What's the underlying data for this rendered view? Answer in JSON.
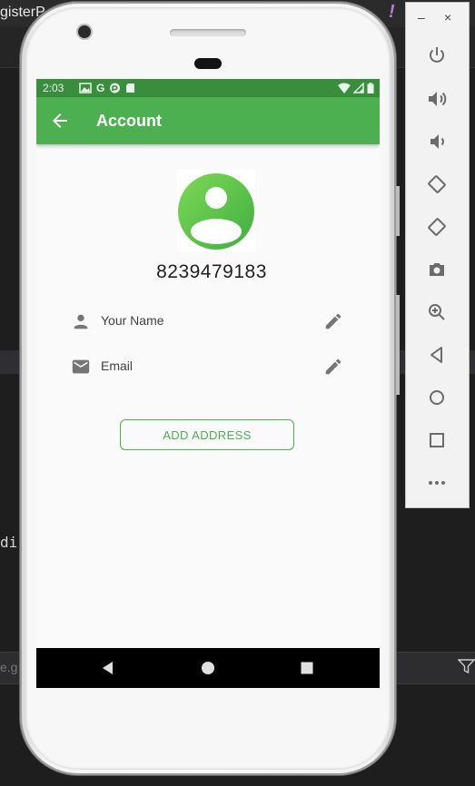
{
  "ide": {
    "title_fragment": "gisterP",
    "code_fragment": "di",
    "filter_fragment": "e.g"
  },
  "status_bar": {
    "time": "2:03",
    "notification_icons": [
      "image-icon",
      "google-icon",
      "google-icon",
      "pocket-icon",
      "sd-card-icon"
    ],
    "system_icons": [
      "wifi-icon",
      "signal-icon",
      "battery-icon"
    ]
  },
  "app_bar": {
    "title": "Account",
    "back_icon": "arrow-back-icon"
  },
  "profile": {
    "avatar_icon": "account-circle-icon",
    "phone_number": "8239479183"
  },
  "fields": [
    {
      "icon": "person-icon",
      "label": "Your Name",
      "edit_icon": "pencil-icon"
    },
    {
      "icon": "mail-icon",
      "label": "Email",
      "edit_icon": "pencil-icon"
    }
  ],
  "add_address_button": {
    "label": "ADD ADDRESS"
  },
  "colors": {
    "primary": "#4caf50",
    "primary_dark": "#388e3c",
    "screen_bg": "#fafafa"
  },
  "emulator_toolbar": {
    "window_controls": [
      "minimize-icon",
      "close-icon"
    ],
    "buttons": [
      "power-icon",
      "volume-up-icon",
      "volume-down-icon",
      "rotate-left-icon",
      "rotate-right-icon",
      "camera-icon",
      "zoom-icon",
      "back-icon",
      "home-icon",
      "overview-icon",
      "more-icon"
    ]
  }
}
